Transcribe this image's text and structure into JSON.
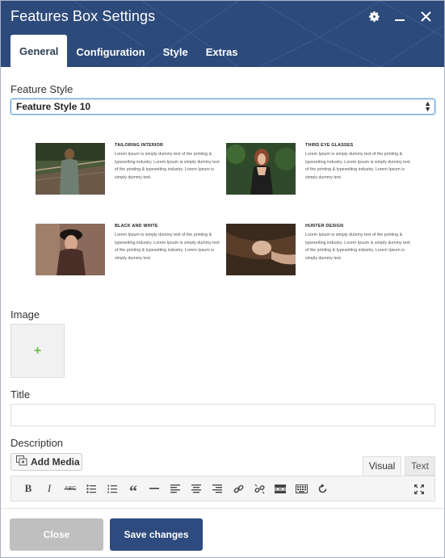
{
  "window": {
    "title": "Features Box Settings"
  },
  "tabs": [
    {
      "label": "General",
      "active": true
    },
    {
      "label": "Configuration",
      "active": false
    },
    {
      "label": "Style",
      "active": false
    },
    {
      "label": "Extras",
      "active": false
    }
  ],
  "feature_style": {
    "label": "Feature Style",
    "selected": "Feature Style 10"
  },
  "preview": {
    "cards": [
      {
        "title": "TAILORING INTERIOR",
        "text": "Lorem Ipsum is simply dummy text of the printing & typesetting industry. Lorem Ipsum is simply dummy text of the printing & typesetting industry. Lorem Ipsum is simply dummy text."
      },
      {
        "title": "THIRD EYE GLASSES",
        "text": "Lorem Ipsum is simply dummy text of the printing & typesetting industry. Lorem Ipsum is simply dummy text of the printing & typesetting industry. Lorem Ipsum is simply dummy text."
      },
      {
        "title": "BLACK AND WHITE",
        "text": "Lorem Ipsum is simply dummy text of the printing & typesetting industry. Lorem Ipsum is simply dummy text of the printing & typesetting industry. Lorem Ipsum is simply dummy text."
      },
      {
        "title": "HUNTER DESIGN",
        "text": "Lorem Ipsum is simply dummy text of the printing & typesetting industry. Lorem Ipsum is simply dummy text of the printing & typesetting industry. Lorem Ipsum is simply dummy text."
      }
    ]
  },
  "image": {
    "label": "Image",
    "add_glyph": "+"
  },
  "title_field": {
    "label": "Title",
    "value": ""
  },
  "description": {
    "label": "Description",
    "add_media_label": "Add Media",
    "tab_visual": "Visual",
    "tab_text": "Text",
    "toolbar_icons": [
      "bold-icon",
      "italic-icon",
      "strikethrough-icon",
      "bullet-list-icon",
      "numbered-list-icon",
      "blockquote-icon",
      "horizontal-rule-icon",
      "align-left-icon",
      "align-center-icon",
      "align-right-icon",
      "link-icon",
      "unlink-icon",
      "read-more-icon",
      "toolbar-toggle-icon",
      "undo-icon",
      "fullscreen-icon"
    ],
    "toolbar_glyphs": {
      "bold": "B",
      "italic": "I",
      "strike": "ABC",
      "quote": "“"
    }
  },
  "footer": {
    "close_label": "Close",
    "save_label": "Save changes"
  },
  "colors": {
    "header": "#2c4a7a",
    "save": "#2d4b7e",
    "close": "#bfbfbf",
    "plus": "#6cc04a"
  }
}
